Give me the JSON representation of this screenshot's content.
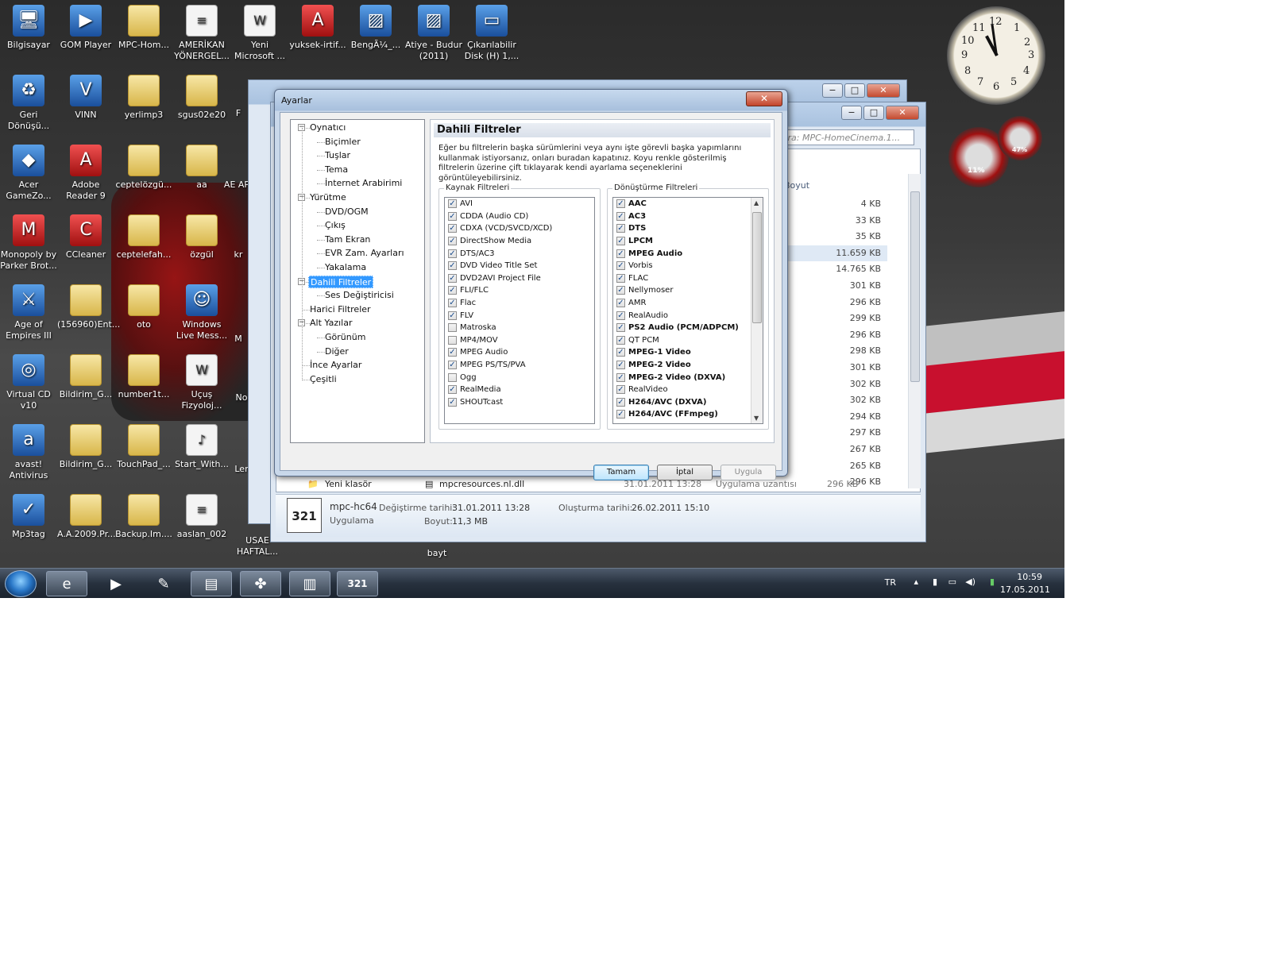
{
  "desktop_icons": [
    {
      "label": "Bilgisayar",
      "icon": "computer-icon"
    },
    {
      "label": "GOM Player",
      "icon": "gom-player-icon"
    },
    {
      "label": "MPC-Hom...",
      "icon": "folder-icon"
    },
    {
      "label": "AMERİKAN YÖNERGEL...",
      "icon": "document-icon"
    },
    {
      "label": "Yeni Microsoft ...",
      "icon": "word-document-icon"
    },
    {
      "label": "yuksek-irtif...",
      "icon": "pdf-icon"
    },
    {
      "label": "BengÃ¼_...",
      "icon": "image-icon"
    },
    {
      "label": "Atiye - Budur (2011)",
      "icon": "image-icon"
    },
    {
      "label": "Çıkarılabilir Disk (H) 1,...",
      "icon": "removable-disk-icon"
    },
    {
      "label": "Geri Dönüşü...",
      "icon": "recycle-bin-icon"
    },
    {
      "label": "VINN",
      "icon": "vinn-icon"
    },
    {
      "label": "yerlimp3",
      "icon": "folder-icon"
    },
    {
      "label": "sgus02e20",
      "icon": "folder-icon"
    },
    {
      "label": "Acer GameZo...",
      "icon": "acer-gamezone-icon"
    },
    {
      "label": "Adobe Reader 9",
      "icon": "adobe-reader-icon"
    },
    {
      "label": "ceptelözgü...",
      "icon": "folder-icon"
    },
    {
      "label": "aa",
      "icon": "folder-icon"
    },
    {
      "label": "Monopoly by Parker Brot...",
      "icon": "monopoly-icon"
    },
    {
      "label": "CCleaner",
      "icon": "ccleaner-icon"
    },
    {
      "label": "ceptelefah...",
      "icon": "folder-icon"
    },
    {
      "label": "özgül",
      "icon": "folder-icon"
    },
    {
      "label": "Age of Empires III",
      "icon": "age-of-empires-icon"
    },
    {
      "label": "(156960)Ent...",
      "icon": "folder-icon"
    },
    {
      "label": "oto",
      "icon": "folder-icon"
    },
    {
      "label": "Windows Live Mess...",
      "icon": "messenger-icon"
    },
    {
      "label": "Virtual CD v10",
      "icon": "virtual-cd-icon"
    },
    {
      "label": "Bildirim_G...",
      "icon": "folder-icon"
    },
    {
      "label": "number1t...",
      "icon": "folder-icon"
    },
    {
      "label": "Uçuş Fizyoloj...",
      "icon": "word-document-icon"
    },
    {
      "label": "avast! Antivirus",
      "icon": "avast-icon"
    },
    {
      "label": "Bildirim_G...",
      "icon": "folder-icon"
    },
    {
      "label": "TouchPad_...",
      "icon": "folder-icon"
    },
    {
      "label": "Start_With...",
      "icon": "audio-file-icon"
    },
    {
      "label": "Mp3tag",
      "icon": "mp3tag-icon"
    },
    {
      "label": "A.A.2009.Pr...",
      "icon": "folder-icon"
    },
    {
      "label": "Backup.Im....",
      "icon": "folder-icon"
    },
    {
      "label": "aaslan_002",
      "icon": "document-icon"
    }
  ],
  "desktop_partial_labels": [
    "F",
    "AE AP",
    "kr",
    "M",
    "No",
    "Ler",
    "USAE HAFTAL...",
    "bayt"
  ],
  "explorer": {
    "search_placeholder": "Ara: MPC-HomeCinema.1...",
    "size_header": "Boyut",
    "sizes": [
      "4 KB",
      "33 KB",
      "35 KB",
      "11.659 KB",
      "14.765 KB",
      "301 KB",
      "296 KB",
      "299 KB",
      "296 KB",
      "298 KB",
      "301 KB",
      "302 KB",
      "302 KB",
      "294 KB",
      "297 KB",
      "267 KB",
      "265 KB",
      "296 KB"
    ],
    "selected_size_index": 3,
    "bottom_row": {
      "folder_name": "Yeni klasör",
      "file_name": "mpcresources.nl.dll",
      "date": "31.01.2011 13:28",
      "type": "Uygulama uzantısı",
      "size": "296 KB"
    },
    "details": {
      "name": "mpc-hc64",
      "type": "Uygulama",
      "modified_label": "Değiştirme tarihi:",
      "modified_value": "31.01.2011 13:28",
      "size_label": "Boyut:",
      "size_value": "11,3 MB",
      "created_label": "Oluşturma tarihi:",
      "created_value": "26.02.2011 15:10"
    }
  },
  "dialog": {
    "title": "Ayarlar",
    "close": "✕",
    "tree": [
      {
        "label": "Oynatıcı",
        "level": 0,
        "expander": "−"
      },
      {
        "label": "Biçimler",
        "level": 1
      },
      {
        "label": "Tuşlar",
        "level": 1
      },
      {
        "label": "Tema",
        "level": 1
      },
      {
        "label": "İnternet Arabirimi",
        "level": 1
      },
      {
        "label": "Yürütme",
        "level": 0,
        "expander": "−"
      },
      {
        "label": "DVD/OGM",
        "level": 1
      },
      {
        "label": "Çıkış",
        "level": 1
      },
      {
        "label": "Tam Ekran",
        "level": 1
      },
      {
        "label": "EVR Zam. Ayarları",
        "level": 1
      },
      {
        "label": "Yakalama",
        "level": 1
      },
      {
        "label": "Dahili Filtreler",
        "level": 0,
        "expander": "−",
        "selected": true
      },
      {
        "label": "Ses Değiştiricisi",
        "level": 1
      },
      {
        "label": "Harici Filtreler",
        "level": 0
      },
      {
        "label": "Alt Yazılar",
        "level": 0,
        "expander": "−"
      },
      {
        "label": "Görünüm",
        "level": 1
      },
      {
        "label": "Diğer",
        "level": 1
      },
      {
        "label": "İnce Ayarlar",
        "level": 0
      },
      {
        "label": "Çeşitli",
        "level": 0
      }
    ],
    "panel_title": "Dahili Filtreler",
    "description": "Eğer bu filtrelerin başka sürümlerini veya aynı işte görevli başka yapımlarını kullanmak istiyorsanız, onları buradan kapatınız. Koyu renkle gösterilmiş filtrelerin üzerine çift tıklayarak kendi ayarlama seçeneklerini görüntüleyebilirsiniz.",
    "source_group_label": "Kaynak Filtreleri",
    "source_filters": [
      {
        "label": "AVI",
        "checked": true
      },
      {
        "label": "CDDA (Audio CD)",
        "checked": true
      },
      {
        "label": "CDXA (VCD/SVCD/XCD)",
        "checked": true
      },
      {
        "label": "DirectShow Media",
        "checked": true
      },
      {
        "label": "DTS/AC3",
        "checked": true
      },
      {
        "label": "DVD Video Title Set",
        "checked": true
      },
      {
        "label": "DVD2AVI Project File",
        "checked": true
      },
      {
        "label": "FLI/FLC",
        "checked": true
      },
      {
        "label": "Flac",
        "checked": true
      },
      {
        "label": "FLV",
        "checked": true
      },
      {
        "label": "Matroska",
        "checked": false
      },
      {
        "label": "MP4/MOV",
        "checked": false
      },
      {
        "label": "MPEG Audio",
        "checked": true
      },
      {
        "label": "MPEG PS/TS/PVA",
        "checked": true
      },
      {
        "label": "Ogg",
        "checked": false
      },
      {
        "label": "RealMedia",
        "checked": true
      },
      {
        "label": "SHOUTcast",
        "checked": true
      }
    ],
    "transform_group_label": "Dönüştürme Filtreleri",
    "transform_filters": [
      {
        "label": "AAC",
        "checked": true,
        "bold": true
      },
      {
        "label": "AC3",
        "checked": true,
        "bold": true
      },
      {
        "label": "DTS",
        "checked": true,
        "bold": true
      },
      {
        "label": "LPCM",
        "checked": true,
        "bold": true
      },
      {
        "label": "MPEG Audio",
        "checked": true,
        "bold": true
      },
      {
        "label": "Vorbis",
        "checked": true,
        "bold": false
      },
      {
        "label": "FLAC",
        "checked": true,
        "bold": false
      },
      {
        "label": "Nellymoser",
        "checked": true,
        "bold": false
      },
      {
        "label": "AMR",
        "checked": true,
        "bold": false
      },
      {
        "label": "RealAudio",
        "checked": true,
        "bold": false
      },
      {
        "label": "PS2 Audio (PCM/ADPCM)",
        "checked": true,
        "bold": true
      },
      {
        "label": "QT PCM",
        "checked": true,
        "bold": false
      },
      {
        "label": "MPEG-1 Video",
        "checked": true,
        "bold": true
      },
      {
        "label": "MPEG-2 Video",
        "checked": true,
        "bold": true
      },
      {
        "label": "MPEG-2 Video (DXVA)",
        "checked": true,
        "bold": true
      },
      {
        "label": "RealVideo",
        "checked": true,
        "bold": false
      },
      {
        "label": "H264/AVC (DXVA)",
        "checked": true,
        "bold": true
      },
      {
        "label": "H264/AVC (FFmpeg)",
        "checked": true,
        "bold": true
      }
    ],
    "buttons": {
      "ok": "Tamam",
      "cancel": "İptal",
      "apply": "Uygula"
    }
  },
  "clock": {
    "numerals": [
      "12",
      "1",
      "2",
      "3",
      "4",
      "5",
      "6",
      "7",
      "8",
      "9",
      "10",
      "11"
    ]
  },
  "meters": {
    "cpu": "11%",
    "memory": "47%"
  },
  "taskbar": {
    "language": "TR",
    "time": "10:59",
    "date": "17.05.2011",
    "buttons": [
      "internet-explorer-icon",
      "media-player-icon",
      "tool-icon",
      "explorer-icon",
      "clover-icon",
      "chart-app-icon",
      "mpc-hc-icon"
    ]
  }
}
